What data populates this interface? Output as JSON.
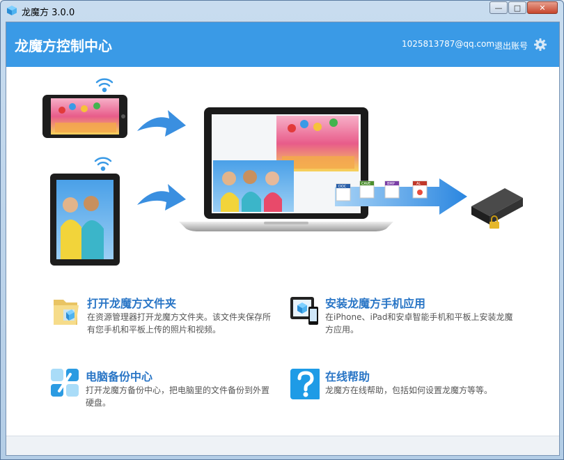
{
  "window": {
    "title": "龙魔方 3.0.0",
    "min_label": "—",
    "max_label": "□",
    "close_label": "✕"
  },
  "header": {
    "title": "龙魔方控制中心",
    "account": "1025813787@qq.com",
    "logout": "退出账号"
  },
  "hero": {
    "file_labels": [
      "DOC",
      "CAVE",
      "BMP",
      "AL"
    ]
  },
  "features": [
    {
      "title": "打开龙魔方文件夹",
      "desc": "在资源管理器打开龙魔方文件夹。该文件夹保存所有您手机和平板上传的照片和视频。",
      "icon": "folder-icon"
    },
    {
      "title": "安装龙魔方手机应用",
      "desc": "在iPhone、iPad和安卓智能手机和平板上安装龙魔方应用。",
      "icon": "devices-icon"
    },
    {
      "title": "电脑备份中心",
      "desc": "打开龙魔方备份中心，把电脑里的文件备份到外置硬盘。",
      "icon": "backup-icon"
    },
    {
      "title": "在线帮助",
      "desc": "龙魔方在线帮助，包括如何设置龙魔方等等。",
      "icon": "help-icon"
    }
  ],
  "colors": {
    "header": "#3a9ae6",
    "link": "#2a76c6",
    "arrow": "#3a8fe0"
  }
}
